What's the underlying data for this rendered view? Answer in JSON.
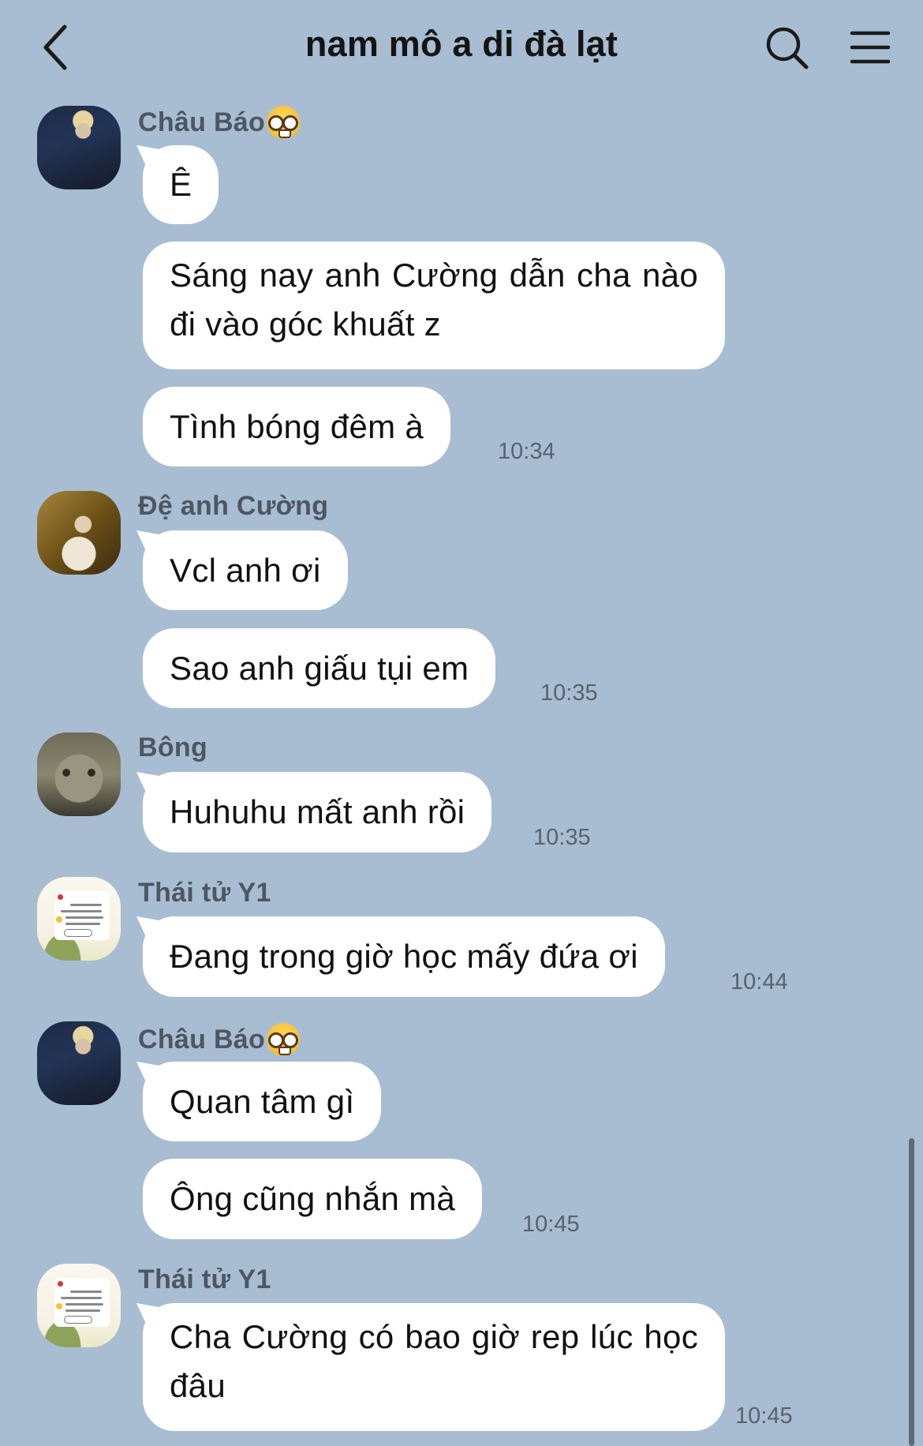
{
  "header": {
    "title": "nam mô a di đà lạt"
  },
  "messages": [
    {
      "sender": "Châu Báo",
      "bubbles": [
        "Ê",
        "Sáng nay anh Cường dẫn cha nào đi vào góc khuất z",
        "Tình bóng đêm à"
      ],
      "time": "10:34"
    },
    {
      "sender": "Đệ anh Cường",
      "bubbles": [
        "Vcl anh ơi",
        "Sao anh giấu tụi em"
      ],
      "time": "10:35"
    },
    {
      "sender": "Bông",
      "bubbles": [
        "Huhuhu mất anh rồi"
      ],
      "time": "10:35"
    },
    {
      "sender": "Thái tử Y1",
      "bubbles": [
        "Đang trong giờ học mấy đứa ơi"
      ],
      "time": "10:44"
    },
    {
      "sender": "Châu Báo",
      "bubbles": [
        "Quan tâm gì",
        "Ông cũng nhắn mà"
      ],
      "time": "10:45"
    },
    {
      "sender": "Thái tử Y1",
      "bubbles": [
        "Cha Cường có bao giờ rep lúc học đâu"
      ],
      "time": "10:45"
    }
  ],
  "icons": {
    "back": "chevron-left-icon",
    "search": "search-icon",
    "menu": "hamburger-menu-icon",
    "name_emoji": "nerd-face-emoji"
  },
  "colors": {
    "background": "#a9bdd2",
    "bubble": "#ffffff",
    "name": "#4d5663",
    "time": "#58626e"
  }
}
